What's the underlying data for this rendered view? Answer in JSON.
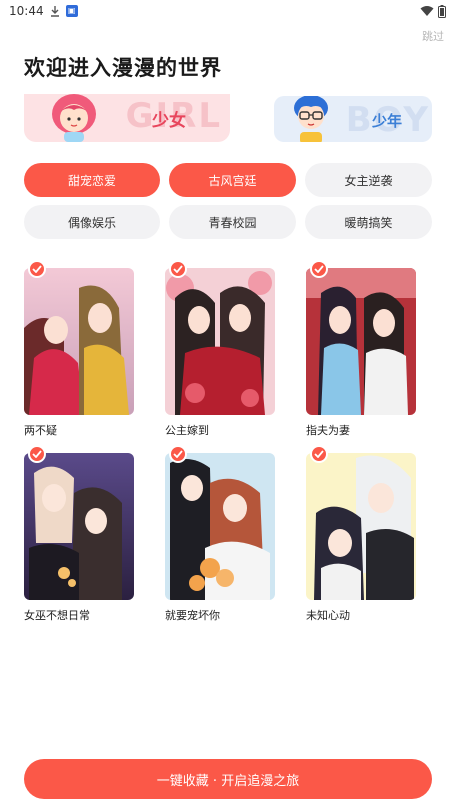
{
  "status_bar": {
    "time": "10:44"
  },
  "skip_label": "跳过",
  "page_title": "欢迎进入漫漫的世界",
  "gender": {
    "girl": {
      "label": "少女",
      "watermark": "GIRL"
    },
    "boy": {
      "label": "少年",
      "watermark": "BOY"
    }
  },
  "tags": [
    {
      "label": "甜宠恋爱",
      "selected": true
    },
    {
      "label": "古风宫廷",
      "selected": true
    },
    {
      "label": "女主逆袭",
      "selected": false
    },
    {
      "label": "偶像娱乐",
      "selected": false
    },
    {
      "label": "青春校园",
      "selected": false
    },
    {
      "label": "暖萌搞笑",
      "selected": false
    }
  ],
  "books": [
    {
      "title": "两不疑",
      "checked": true
    },
    {
      "title": "公主嫁到",
      "checked": true
    },
    {
      "title": "指夫为妻",
      "checked": true
    },
    {
      "title": "女巫不想日常",
      "checked": true
    },
    {
      "title": "就要宠坏你",
      "checked": true
    },
    {
      "title": "未知心动",
      "checked": true
    }
  ],
  "cta_label": "一键收藏 · 开启追漫之旅",
  "colors": {
    "accent": "#fb5848",
    "tag_off_bg": "#f2f2f4",
    "skip_text": "#b8b8b8"
  },
  "icons": [
    "download-icon",
    "app-notification-icon",
    "wifi-icon",
    "battery-icon",
    "checkmark-icon"
  ]
}
